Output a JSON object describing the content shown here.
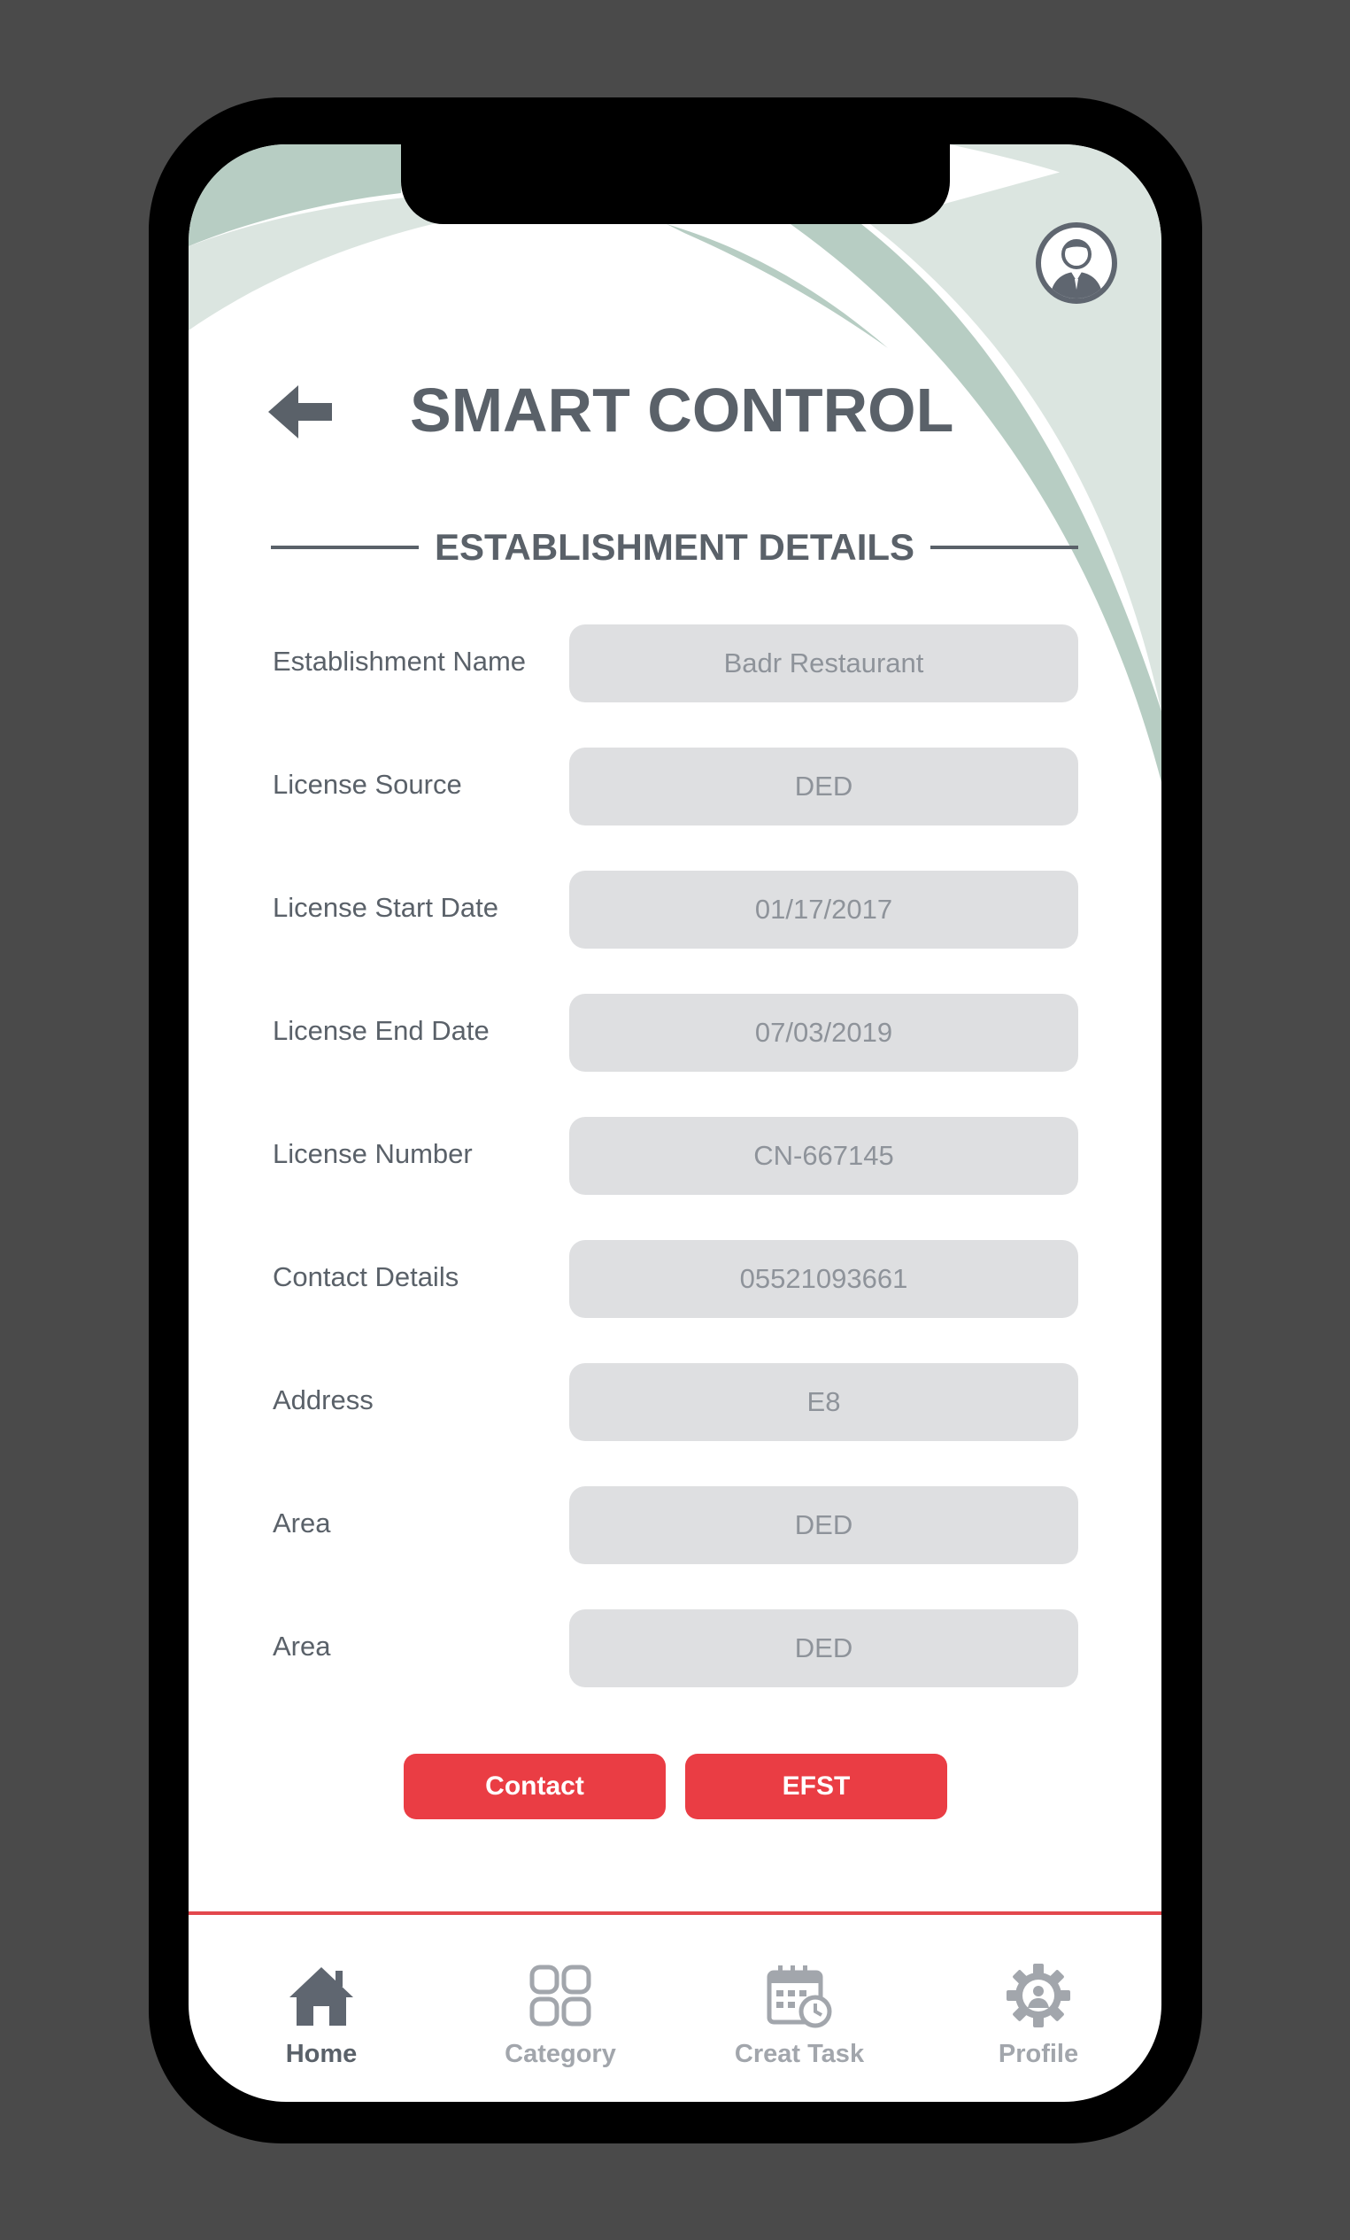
{
  "header": {
    "title": "SMART CONTROL",
    "back_icon": "back-arrow-icon",
    "avatar_icon": "user-avatar-icon"
  },
  "section": {
    "title": "ESTABLISHMENT DETAILS"
  },
  "fields": [
    {
      "label": "Establishment Name",
      "value": "Badr Restaurant"
    },
    {
      "label": "License Source",
      "value": "DED"
    },
    {
      "label": "License Start Date",
      "value": "01/17/2017"
    },
    {
      "label": "License End Date",
      "value": "07/03/2019"
    },
    {
      "label": "License Number",
      "value": "CN-667145"
    },
    {
      "label": "Contact Details",
      "value": "05521093661"
    },
    {
      "label": "Address",
      "value": "E8"
    },
    {
      "label": "Area",
      "value": "DED"
    },
    {
      "label": "Area",
      "value": "DED"
    }
  ],
  "actions": {
    "contact_label": "Contact",
    "efst_label": "EFST"
  },
  "nav": {
    "items": [
      {
        "label": "Home",
        "icon": "home-icon",
        "active": true
      },
      {
        "label": "Category",
        "icon": "category-grid-icon",
        "active": false
      },
      {
        "label": "Creat Task",
        "icon": "calendar-clock-icon",
        "active": false
      },
      {
        "label": "Profile",
        "icon": "gear-user-icon",
        "active": false
      }
    ]
  },
  "colors": {
    "accent": "#ea3d44",
    "text": "#5a6169",
    "field_bg": "#dedfe1",
    "decor_green": "#b7cdc3",
    "decor_light": "#dbe5e0",
    "device_bg": "#4a4a4a"
  }
}
